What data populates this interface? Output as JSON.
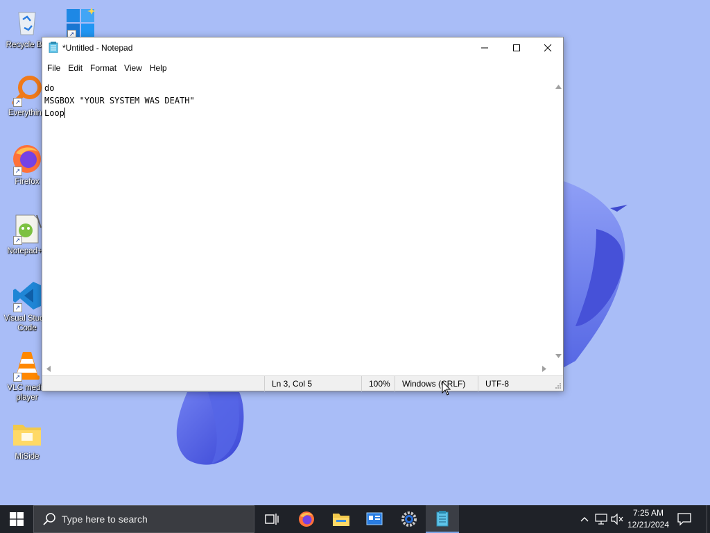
{
  "desktop": {
    "icons": [
      {
        "label": "Recycle Bin",
        "icon": "recycle-bin-icon"
      },
      {
        "label": "",
        "icon": "windows-11-icon"
      },
      {
        "label": "Everything",
        "icon": "everything-search-icon"
      },
      {
        "label": "Firefox",
        "icon": "firefox-icon"
      },
      {
        "label": "Notepad++",
        "icon": "notepad-plus-plus-icon"
      },
      {
        "label": "Visual Studio\nCode",
        "icon": "vscode-icon"
      },
      {
        "label": "VLC media\nplayer",
        "icon": "vlc-icon"
      },
      {
        "label": "MiSide",
        "icon": "folder-icon"
      }
    ]
  },
  "notepad": {
    "title": "*Untitled - Notepad",
    "menu": [
      "File",
      "Edit",
      "Format",
      "View",
      "Help"
    ],
    "content_lines": [
      "do",
      "MSGBOX \"YOUR SYSTEM WAS DEATH\"",
      "Loop"
    ],
    "status": {
      "position": "Ln 3, Col 5",
      "zoom": "100%",
      "line_ending": "Windows (CRLF)",
      "encoding": "UTF-8"
    }
  },
  "taskbar": {
    "search_placeholder": "Type here to search",
    "apps": [
      "task-view-icon",
      "firefox-icon",
      "file-explorer-icon",
      "control-panel-icon",
      "settings-icon",
      "notepad-icon"
    ],
    "clock": {
      "time": "7:25 AM",
      "date": "12/21/2024"
    }
  },
  "colors": {
    "wallpaper": "#a9bdf7",
    "taskbar": "#1f2228",
    "accent": "#4a5ad8"
  }
}
